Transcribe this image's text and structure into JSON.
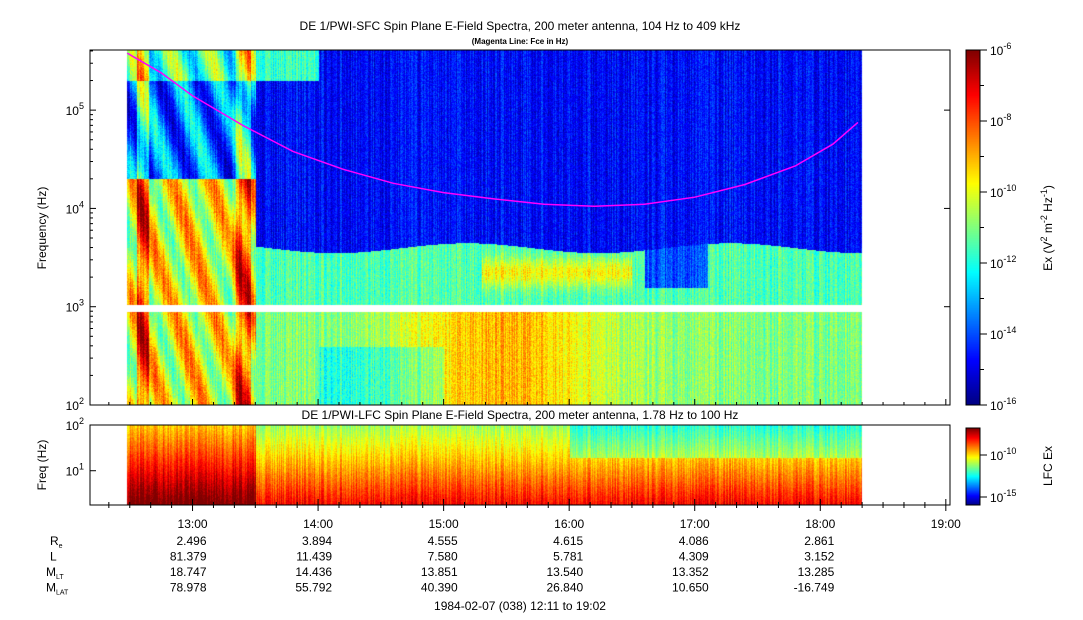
{
  "chart_data": [
    {
      "type": "heatmap",
      "title": "DE 1/PWI-SFC  Spin Plane E-Field Spectra, 200 meter antenna, 104 Hz to 409 kHz",
      "subtitle": "(Magenta Line: Fce in Hz)",
      "ylabel": "Frequency (Hz)",
      "yscale": "log",
      "ylim": [
        100,
        409000
      ],
      "yticks": [
        {
          "v": 100,
          "m": "2"
        },
        {
          "v": 1000,
          "m": "3"
        },
        {
          "v": 10000,
          "m": "4"
        },
        {
          "v": 100000,
          "m": "5"
        }
      ],
      "colorbar": {
        "label_main": "Ex (V",
        "label_sup1": "2",
        "label_mid": " m",
        "label_sup2": "-2",
        "label_hz": " Hz",
        "label_sup3": "-1",
        "label_end": ")",
        "ticks": [
          {
            "b": "10",
            "e": "-6"
          },
          {
            "b": "10",
            "e": "-8"
          },
          {
            "b": "10",
            "e": "-10"
          },
          {
            "b": "10",
            "e": "-12"
          },
          {
            "b": "10",
            "e": "-14"
          },
          {
            "b": "10",
            "e": "-16"
          }
        ],
        "range_log10": [
          -16,
          -6
        ]
      },
      "data_coverage_hours": [
        12.48,
        18.33
      ],
      "gap_hz": [
        900,
        1050
      ],
      "fce_line": {
        "color": "#ff00ff",
        "t": [
          12.48,
          12.75,
          13.0,
          13.4,
          13.8,
          14.2,
          14.6,
          15.0,
          15.4,
          15.8,
          16.2,
          16.6,
          17.0,
          17.4,
          17.8,
          18.1,
          18.3
        ],
        "hz": [
          380000,
          240000,
          140000,
          70000,
          38000,
          25000,
          18000,
          14500,
          12500,
          11000,
          10500,
          11000,
          13000,
          17500,
          27000,
          45000,
          75000
        ]
      }
    },
    {
      "type": "heatmap",
      "title": "DE 1/PWI-LFC  Spin Plane E-Field Spectra, 200 meter antenna, 1.78 Hz to 100 Hz",
      "ylabel": "Freq (Hz)",
      "yscale": "log",
      "ylim": [
        1.78,
        100
      ],
      "yticks": [
        {
          "v": 10,
          "m": "1"
        },
        {
          "v": 100,
          "m": "2"
        }
      ],
      "colorbar": {
        "label": "LFC Ex",
        "ticks": [
          {
            "b": "10",
            "e": "-10"
          },
          {
            "b": "10",
            "e": "-15"
          }
        ]
      }
    }
  ],
  "xaxis": {
    "ticks": [
      "13:00",
      "14:00",
      "15:00",
      "16:00",
      "17:00",
      "18:00",
      "19:00"
    ],
    "range_hours": [
      12.1833,
      19.0333
    ],
    "caption": "1984-02-07 (038) 12:11 to 19:02"
  },
  "ephemeris": [
    {
      "label": "R",
      "sub": "e",
      "values": [
        "2.496",
        "3.894",
        "4.555",
        "4.615",
        "4.086",
        "2.861"
      ]
    },
    {
      "label": "L",
      "sub": "",
      "values": [
        "81.379",
        "11.439",
        "7.580",
        "5.781",
        "4.309",
        "3.152"
      ]
    },
    {
      "label": "M",
      "sub": "LT",
      "values": [
        "18.747",
        "14.436",
        "13.851",
        "13.540",
        "13.352",
        "13.285"
      ]
    },
    {
      "label": "M",
      "sub": "LAT",
      "values": [
        "78.978",
        "55.792",
        "40.390",
        "26.840",
        "10.650",
        "-16.749"
      ]
    }
  ]
}
